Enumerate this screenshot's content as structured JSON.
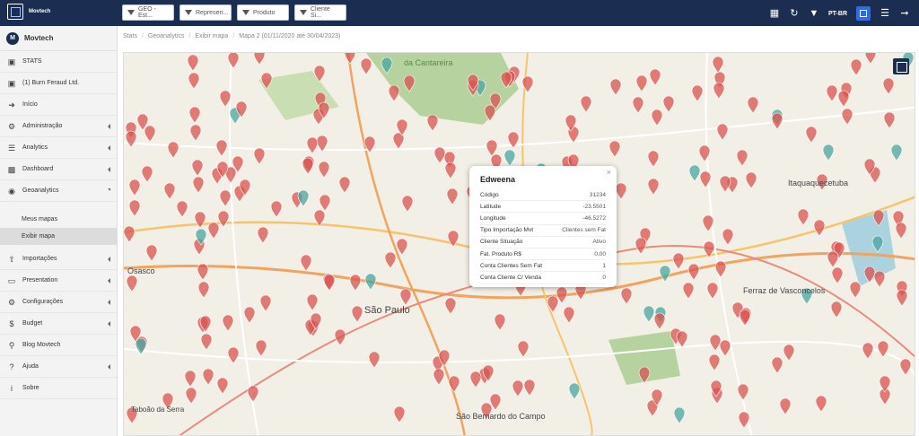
{
  "brand": {
    "name": "Movtech"
  },
  "filters": [
    {
      "label": "GEO - Est..."
    },
    {
      "label": "Represen..."
    },
    {
      "label": "Produto"
    },
    {
      "label": "Cliente Si..."
    }
  ],
  "topbar": {
    "language": "PT-BR"
  },
  "user": {
    "initial": "M",
    "name": "Movtech"
  },
  "sidebar": {
    "items": [
      {
        "label": "STATS",
        "icon": "cube-icon"
      },
      {
        "label": "(1) Burn Feraud Ltd.",
        "icon": "cube-icon"
      },
      {
        "label": "Início",
        "icon": "login-icon"
      },
      {
        "label": "Administração",
        "icon": "gear-icon"
      },
      {
        "label": "Analytics",
        "icon": "tasks-icon"
      },
      {
        "label": "Dashboard",
        "icon": "bar-chart-icon"
      },
      {
        "label": "Geoanalytics",
        "icon": "globe-icon"
      }
    ],
    "sub_items": [
      {
        "label": "Meus mapas"
      },
      {
        "label": "Exibir mapa"
      }
    ],
    "items_after": [
      {
        "label": "Importações",
        "icon": "upload-icon"
      },
      {
        "label": "Presentation",
        "icon": "monitor-icon"
      },
      {
        "label": "Configurações",
        "icon": "gears-icon"
      },
      {
        "label": "Budget",
        "icon": "dollar-icon"
      },
      {
        "label": "Blog Movtech",
        "icon": "search-icon"
      },
      {
        "label": "Ajuda",
        "icon": "question-icon"
      },
      {
        "label": "Sobre",
        "icon": "info-icon"
      }
    ]
  },
  "breadcrumb": [
    "Stats",
    "Geoanalytics",
    "Exibir mapa",
    "Mapa 2 (01/11/2020 até 30/04/2023)"
  ],
  "map_labels": {
    "cantareira": "da Cantareira",
    "sao_paulo": "São Paulo",
    "osasco": "Osasco",
    "ferraz": "Ferraz de Vasconcelos",
    "itaquaquecetuba": "Itaquaquecetuba",
    "sao_bernardo": "São Bernardo do Campo",
    "taboao": "Taboão da Serra"
  },
  "popup": {
    "title": "Edweena",
    "rows": [
      {
        "k": "Código",
        "v": "31234"
      },
      {
        "k": "Latitude",
        "v": "-23.5501"
      },
      {
        "k": "Longitude",
        "v": "-46.5272"
      },
      {
        "k": "Tipo Importação Mvt",
        "v": "Clientes sem Fat"
      },
      {
        "k": "Cliente Situação",
        "v": "Ativo"
      },
      {
        "k": "Fat. Produto R$",
        "v": "0,00"
      },
      {
        "k": "Conta Clientes Sem Fat",
        "v": "1"
      },
      {
        "k": "Conta Cliente C/ Venda",
        "v": "0"
      }
    ]
  },
  "colors": {
    "topbar": "#1c2d52",
    "marker_red": "#d9534f",
    "marker_teal": "#4aa6a0",
    "park": "#b5d29f"
  }
}
